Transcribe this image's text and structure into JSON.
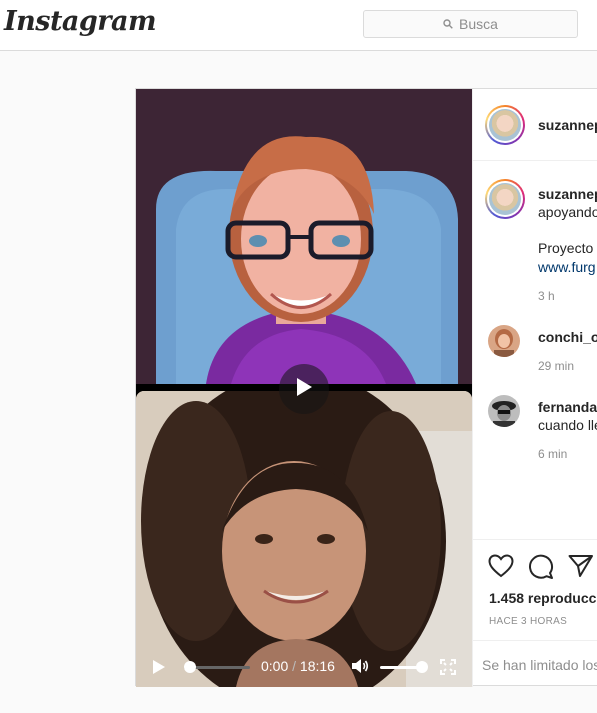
{
  "header": {
    "logo": "Instagram",
    "search_placeholder": "Busca"
  },
  "post": {
    "author": {
      "username": "suzannep"
    },
    "caption": {
      "line1": "apoyando",
      "line2": "Proyecto",
      "link": "www.furg",
      "time": "3 h"
    },
    "comments": [
      {
        "username": "conchi_ol",
        "text": "",
        "time": "29 min"
      },
      {
        "username": "fernanda_",
        "text": "cuando lle",
        "time": "6 min"
      }
    ],
    "video": {
      "current_time": "0:00",
      "separator": "/",
      "duration": "18:16",
      "progress": 0,
      "volume": 0.85
    },
    "views": "1.458 reproducci",
    "posted": "HACE 3 HORAS",
    "comments_limited": "Se han limitado los"
  },
  "colors": {
    "link": "#00376b",
    "muted": "#8e8e8e",
    "border": "#dbdbdb"
  },
  "icons": [
    "search-icon",
    "play-icon",
    "volume-icon",
    "fullscreen-icon",
    "heart-icon",
    "comment-icon",
    "share-icon"
  ]
}
